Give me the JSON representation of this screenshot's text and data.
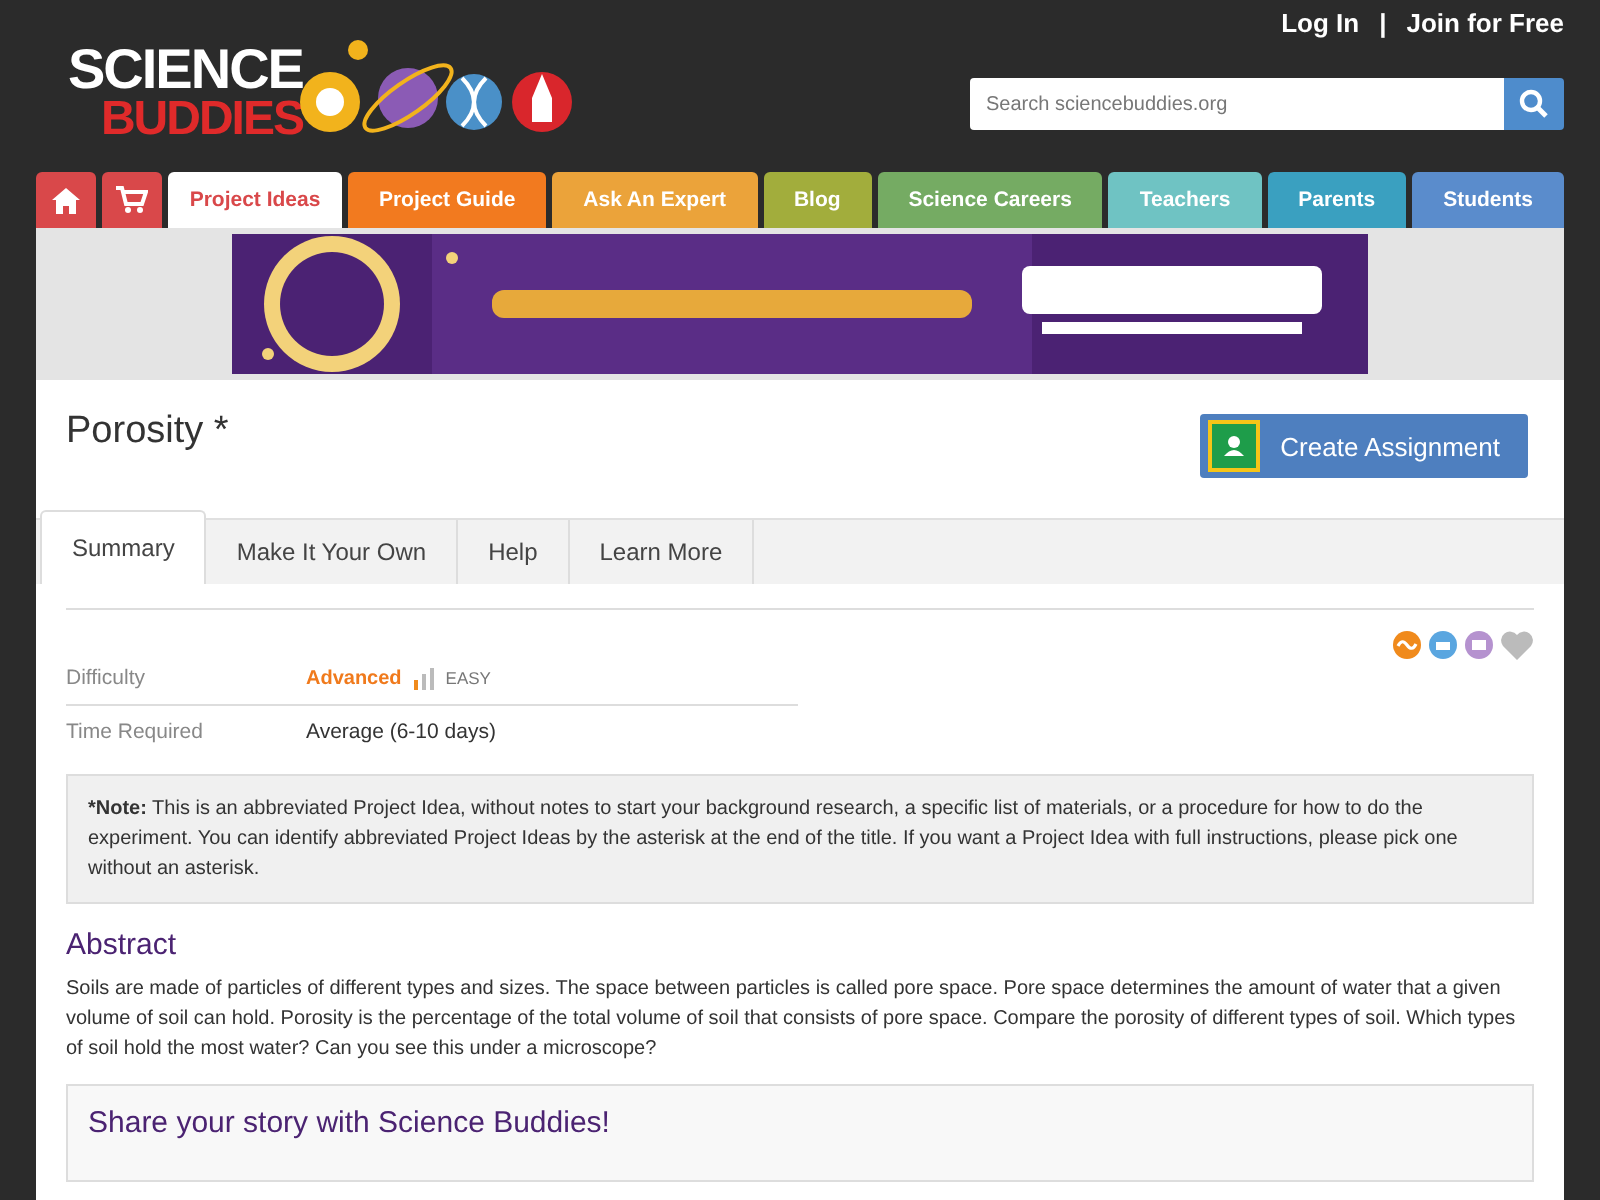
{
  "header": {
    "logo": {
      "line1": "SCIENCE",
      "line2": "BUDDIES"
    },
    "links": [
      "Log In",
      "Join for Free"
    ],
    "separator": "|",
    "search": {
      "placeholder": "Search sciencebuddies.org"
    }
  },
  "nav": [
    {
      "kind": "home",
      "selected": false,
      "color": "#d9484a"
    },
    {
      "kind": "cart",
      "selected": false,
      "color": "#d9484a"
    },
    {
      "kind": "text",
      "label": "Project Ideas",
      "selected": true,
      "color": "#d9484a"
    },
    {
      "kind": "text",
      "label": "Project Guide",
      "selected": false,
      "color": "#f27a1f"
    },
    {
      "kind": "text",
      "label": "Ask An Expert",
      "selected": false,
      "color": "#eba33a"
    },
    {
      "kind": "text",
      "label": "Blog",
      "selected": false,
      "color": "#a2ad3c"
    },
    {
      "kind": "text",
      "label": "Science Careers",
      "selected": false,
      "color": "#75ab63"
    },
    {
      "kind": "text",
      "label": "Teachers",
      "selected": false,
      "color": "#6fc3c3"
    },
    {
      "kind": "text",
      "label": "Parents",
      "selected": false,
      "color": "#3aa0c0"
    },
    {
      "kind": "text",
      "label": "Students",
      "selected": false,
      "color": "#5a8ccc"
    }
  ],
  "title": "Porosity *",
  "create_button": "Create Assignment",
  "tabs": [
    {
      "label": "Summary",
      "selected": true
    },
    {
      "label": "Make It Your Own",
      "selected": false
    },
    {
      "label": "Help",
      "selected": false
    },
    {
      "label": "Learn More",
      "selected": false
    }
  ],
  "details": [
    {
      "label": "Difficulty",
      "value": "Advanced",
      "note": "EASY"
    },
    {
      "label": "Time Required",
      "value": "Average (6-10 days)"
    }
  ],
  "note": {
    "label": "*Note:",
    "text": "This is an abbreviated Project Idea, without notes to start your background research, a specific list of materials, or a procedure for how to do the experiment. You can identify abbreviated Project Ideas by the asterisk at the end of the title. If you want a Project Idea with full instructions, please pick one without an asterisk."
  },
  "abstract": {
    "heading": "Abstract",
    "text": "Soils are made of particles of different types and sizes. The space between particles is called pore space. Pore space determines the amount of water that a given volume of soil can hold. Porosity is the percentage of the total volume of soil that consists of pore space. Compare the porosity of different types of soil. Which types of soil hold the most water? Can you see this under a microscope?"
  },
  "share": {
    "heading": "Share your story with Science Buddies!"
  }
}
